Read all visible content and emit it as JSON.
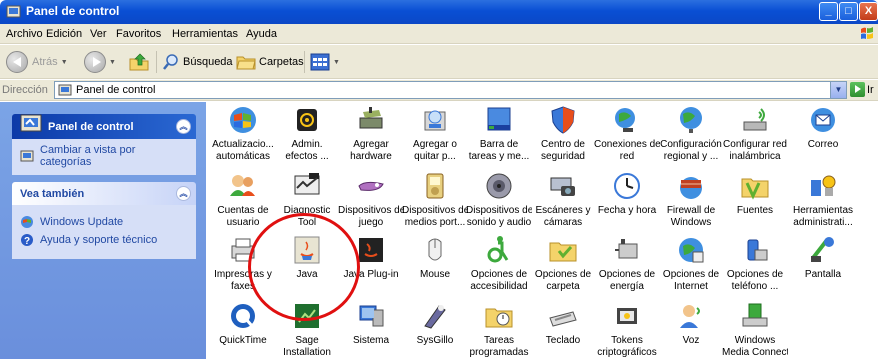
{
  "window": {
    "title": "Panel de control",
    "controls": {
      "minimize": "_",
      "maximize": "□",
      "close": "X"
    }
  },
  "menu": {
    "items": [
      "Archivo",
      "Edición",
      "Ver",
      "Favoritos",
      "Herramientas",
      "Ayuda"
    ]
  },
  "toolbar": {
    "back_label": "Atrás",
    "search_label": "Búsqueda",
    "folders_label": "Carpetas"
  },
  "address": {
    "label": "Dirección",
    "value": "Panel de control",
    "go_label": "Ir"
  },
  "sidebar": {
    "panel_title": "Panel de control",
    "switch_view": "Cambiar a vista por categorías",
    "see_also_title": "Vea también",
    "links": [
      "Windows Update",
      "Ayuda y soporte técnico"
    ]
  },
  "items": [
    {
      "line1": "Actualizacio...",
      "line2": "automáticas",
      "icon": "automatic-updates-icon"
    },
    {
      "line1": "Admin.",
      "line2": "efectos ...",
      "icon": "audio-effects-icon"
    },
    {
      "line1": "Agregar",
      "line2": "hardware",
      "icon": "add-hardware-icon"
    },
    {
      "line1": "Agregar o",
      "line2": "quitar p...",
      "icon": "add-remove-programs-icon"
    },
    {
      "line1": "Barra de",
      "line2": "tareas y me...",
      "icon": "taskbar-icon"
    },
    {
      "line1": "Centro de",
      "line2": "seguridad",
      "icon": "security-center-icon"
    },
    {
      "line1": "Conexiones de",
      "line2": "red",
      "icon": "network-connections-icon"
    },
    {
      "line1": "Configuración",
      "line2": "regional y ...",
      "icon": "regional-settings-icon"
    },
    {
      "line1": "Configurar red",
      "line2": "inalámbrica",
      "icon": "wireless-network-icon"
    },
    {
      "line1": "Correo",
      "line2": "",
      "icon": "mail-icon"
    },
    {
      "line1": "Cuentas de",
      "line2": "usuario",
      "icon": "user-accounts-icon"
    },
    {
      "line1": "Diagnostic",
      "line2": "Tool",
      "icon": "diagnostic-tool-icon"
    },
    {
      "line1": "Dispositivos de",
      "line2": "juego",
      "icon": "game-controllers-icon"
    },
    {
      "line1": "Dispositivos de",
      "line2": "medios port...",
      "icon": "portable-media-icon"
    },
    {
      "line1": "Dispositivos de",
      "line2": "sonido y audio",
      "icon": "sound-audio-icon"
    },
    {
      "line1": "Escáneres y",
      "line2": "cámaras",
      "icon": "scanners-cameras-icon"
    },
    {
      "line1": "Fecha y hora",
      "line2": "",
      "icon": "date-time-icon"
    },
    {
      "line1": "Firewall de",
      "line2": "Windows",
      "icon": "firewall-icon"
    },
    {
      "line1": "Fuentes",
      "line2": "",
      "icon": "fonts-folder-icon"
    },
    {
      "line1": "Herramientas",
      "line2": "administrati...",
      "icon": "admin-tools-icon"
    },
    {
      "line1": "Impresoras y",
      "line2": "faxes",
      "icon": "printers-faxes-icon"
    },
    {
      "line1": "Java",
      "line2": "",
      "icon": "java-icon"
    },
    {
      "line1": "Java Plug-in",
      "line2": "",
      "icon": "java-plugin-icon"
    },
    {
      "line1": "Mouse",
      "line2": "",
      "icon": "mouse-icon"
    },
    {
      "line1": "Opciones de",
      "line2": "accesibilidad",
      "icon": "accessibility-icon"
    },
    {
      "line1": "Opciones de",
      "line2": "carpeta",
      "icon": "folder-options-icon"
    },
    {
      "line1": "Opciones de",
      "line2": "energía",
      "icon": "power-options-icon"
    },
    {
      "line1": "Opciones de",
      "line2": "Internet",
      "icon": "internet-options-icon"
    },
    {
      "line1": "Opciones de",
      "line2": "teléfono ...",
      "icon": "phone-modem-icon"
    },
    {
      "line1": "Pantalla",
      "line2": "",
      "icon": "display-icon"
    },
    {
      "line1": "QuickTime",
      "line2": "",
      "icon": "quicktime-icon"
    },
    {
      "line1": "Sage",
      "line2": "Installation",
      "icon": "sage-installation-icon"
    },
    {
      "line1": "Sistema",
      "line2": "",
      "icon": "system-icon"
    },
    {
      "line1": "SysGillo",
      "line2": "",
      "icon": "sysgillo-icon"
    },
    {
      "line1": "Tareas",
      "line2": "programadas",
      "icon": "scheduled-tasks-icon"
    },
    {
      "line1": "Teclado",
      "line2": "",
      "icon": "keyboard-icon"
    },
    {
      "line1": "Tokens",
      "line2": "criptográficos",
      "icon": "crypto-tokens-icon"
    },
    {
      "line1": "Voz",
      "line2": "",
      "icon": "speech-icon"
    },
    {
      "line1": "Windows",
      "line2": "Media Connect",
      "icon": "media-connect-icon"
    }
  ]
}
